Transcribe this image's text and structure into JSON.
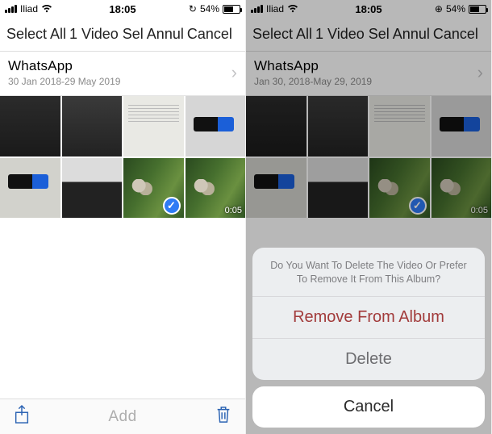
{
  "status": {
    "carrier": "Iliad",
    "time": "18:05",
    "battery_pct": "54%"
  },
  "nav": {
    "select_all": "Select All",
    "selection": "1 Video Sel",
    "annul": "Annul",
    "cancel": "Cancel"
  },
  "album_left": {
    "title": "WhatsApp",
    "subtitle": "30 Jan 2018-29 May 2019"
  },
  "album_right": {
    "title": "WhatsApp",
    "subtitle": "Jan 30, 2018-May 29, 2019"
  },
  "video": {
    "duration": "0:05"
  },
  "toolbar": {
    "add": "Add"
  },
  "sheet": {
    "message": "Do You Want To Delete The Video Or Prefer To Remove It From This Album?",
    "remove": "Remove From Album",
    "delete": "Delete",
    "cancel": "Cancel"
  }
}
